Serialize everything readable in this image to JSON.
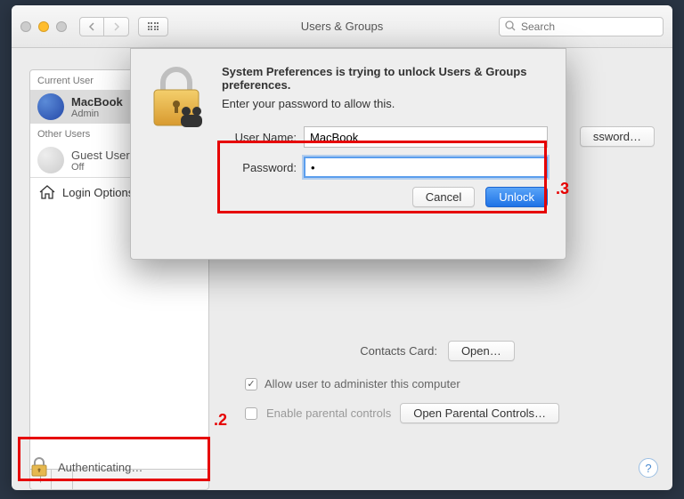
{
  "window": {
    "title": "Users & Groups",
    "search_placeholder": "Search"
  },
  "sidebar": {
    "current_header": "Current User",
    "other_header": "Other Users",
    "current": {
      "name": "MacBook",
      "role": "Admin"
    },
    "other": {
      "name": "Guest User",
      "role": "Off"
    },
    "login_options": "Login Options"
  },
  "main": {
    "change_password": "ssword…",
    "contacts_label": "Contacts Card:",
    "open_btn": "Open…",
    "admin_checkbox": "Allow user to administer this computer",
    "parental_label": "Enable parental controls",
    "parental_btn": "Open Parental Controls…"
  },
  "lockbar": {
    "text": "Authenticating…"
  },
  "help": "?",
  "dialog": {
    "title": "System Preferences is trying to unlock Users & Groups preferences.",
    "subtitle": "Enter your password to allow this.",
    "username_label": "User Name:",
    "username_value": "MacBook",
    "password_label": "Password:",
    "password_value": "•",
    "cancel": "Cancel",
    "unlock": "Unlock"
  },
  "annotations": {
    "box2": ".2",
    "box3": ".3"
  }
}
